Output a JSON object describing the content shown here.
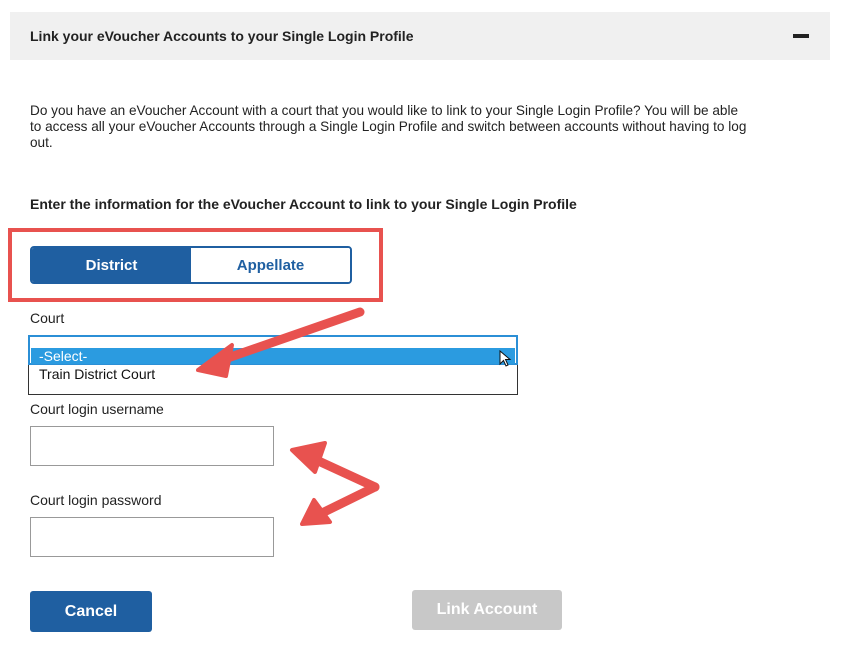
{
  "panel": {
    "title": "Link your eVoucher Accounts to your Single Login Profile",
    "collapse_icon": "minus-icon"
  },
  "intro_text": "Do you have an eVoucher Account with a court that you would like to link to your Single Login Profile? You will be able to access all your eVoucher Accounts through a Single Login Profile and switch between accounts without having to log out.",
  "section_heading": "Enter the information for the eVoucher Account to link to your Single Login Profile",
  "court_type_toggle": {
    "options": [
      "District",
      "Appellate"
    ],
    "selected": "District"
  },
  "court": {
    "label": "Court",
    "options": [
      "-Select-",
      "Train District Court"
    ],
    "selected": "-Select-"
  },
  "username": {
    "label": "Court login username",
    "value": ""
  },
  "password": {
    "label": "Court login password",
    "value": ""
  },
  "buttons": {
    "cancel": "Cancel",
    "link_account": "Link Account"
  },
  "colors": {
    "primary": "#1f5fa1",
    "highlight": "#e8524f",
    "select_highlight": "#2b9be0",
    "disabled": "#c8c8c8"
  }
}
